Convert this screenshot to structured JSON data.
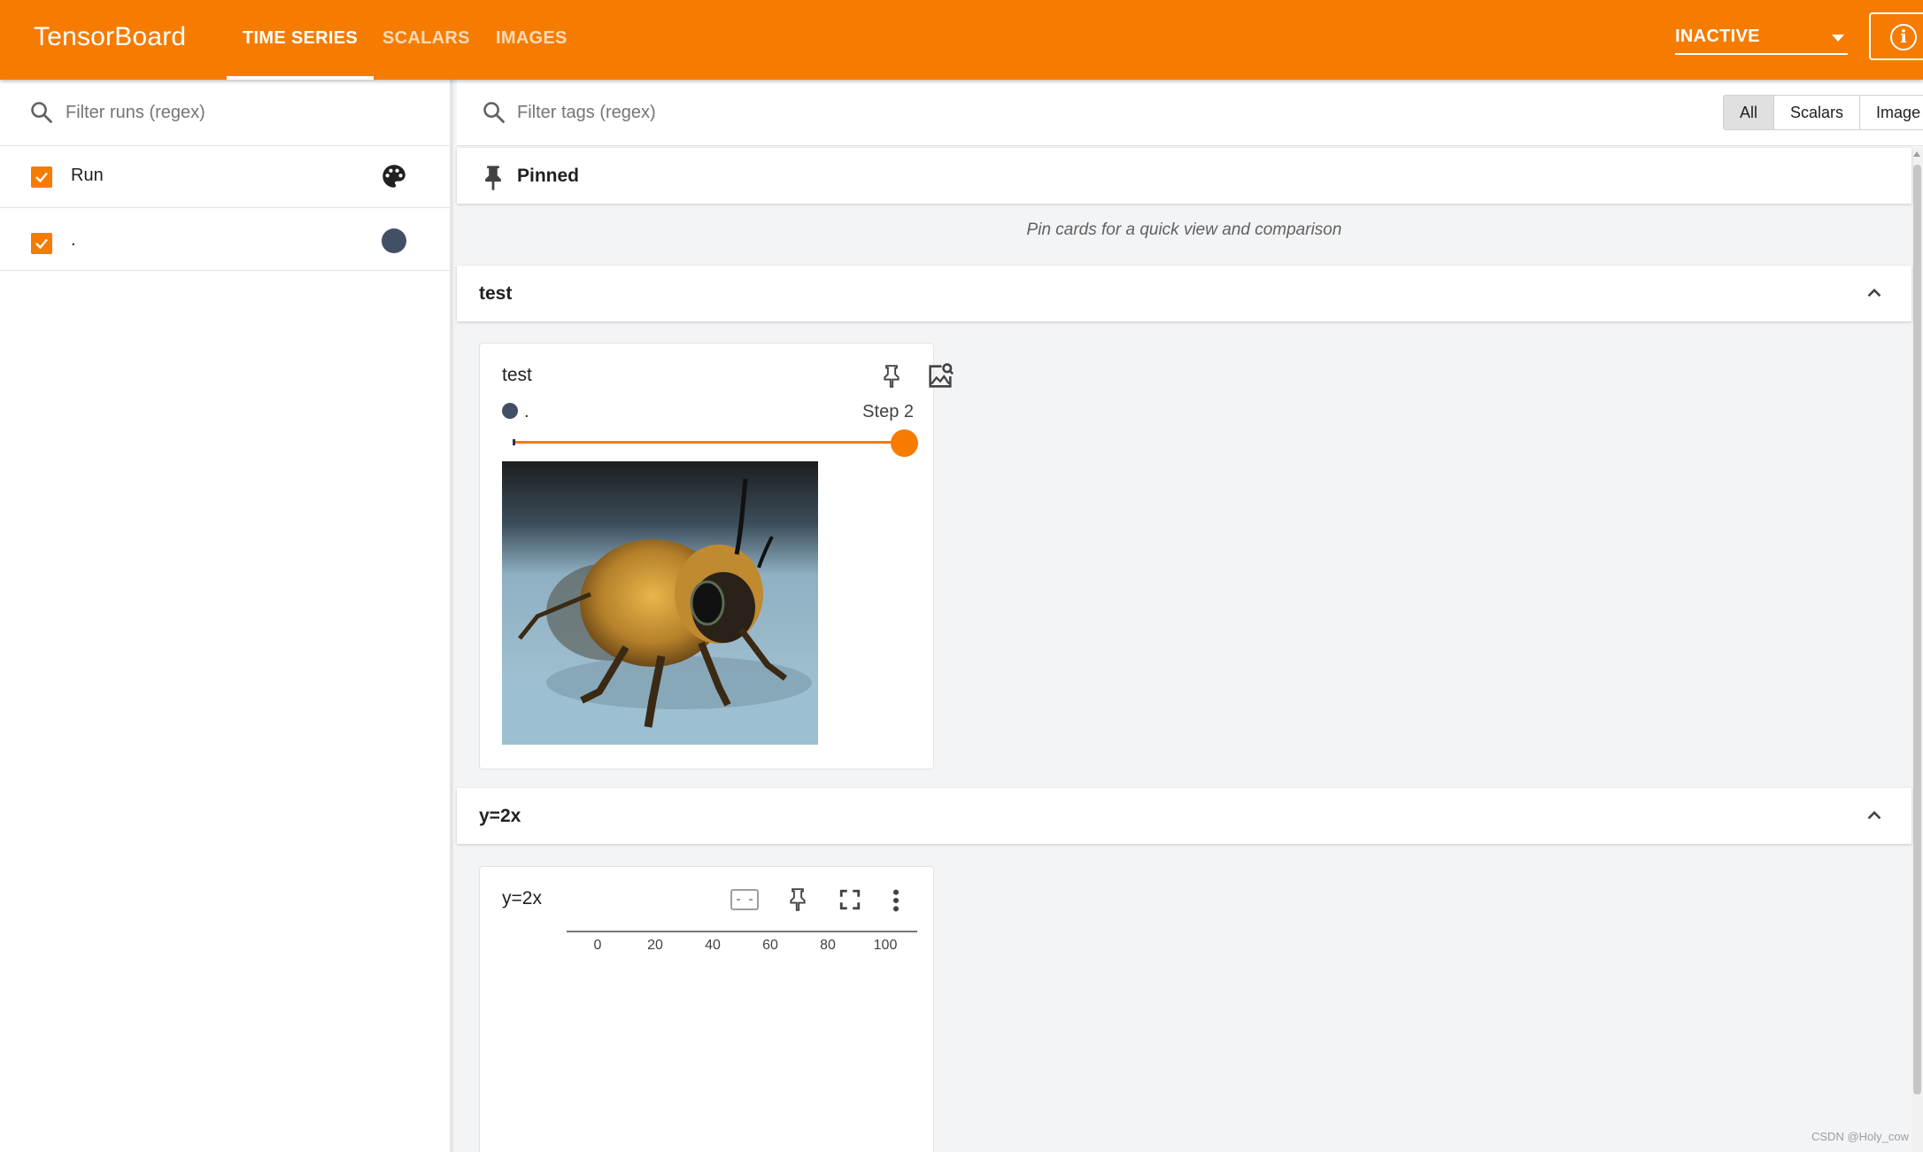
{
  "app": {
    "name": "TensorBoard",
    "tabs": [
      "TIME SERIES",
      "SCALARS",
      "IMAGES"
    ],
    "active_tab": "TIME SERIES",
    "reload_status": "INACTIVE",
    "accent_color": "#f57c00"
  },
  "sidebar": {
    "filter_placeholder": "Filter runs (regex)",
    "runs": [
      {
        "label": "Run",
        "checked": true,
        "control": "palette-icon"
      },
      {
        "label": ".",
        "checked": true,
        "color": "#425066"
      }
    ]
  },
  "main": {
    "tag_filter_placeholder": "Filter tags (regex)",
    "type_filters": [
      "All",
      "Scalars",
      "Image"
    ],
    "selected_type": "All",
    "pinned": {
      "title": "Pinned",
      "empty_message": "Pin cards for a quick view and comparison"
    },
    "groups": [
      {
        "name": "test",
        "card": {
          "title": "test",
          "run_name": ".",
          "step_label": "Step 2",
          "slider_fraction": 1.0,
          "image": "bee-photo"
        }
      },
      {
        "name": "y=2x",
        "card": {
          "title": "y=2x",
          "x_ticks": [
            "0",
            "20",
            "40",
            "60",
            "80",
            "100"
          ]
        }
      }
    ]
  },
  "watermark": "CSDN @Holy_cow"
}
